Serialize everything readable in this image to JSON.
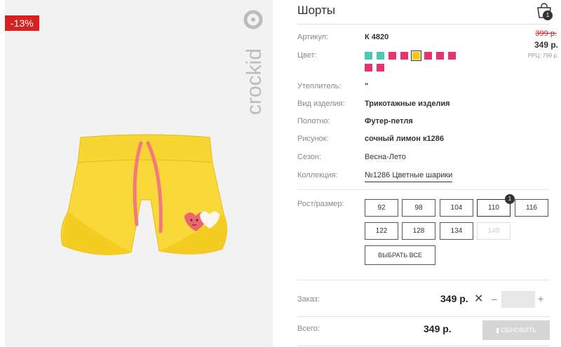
{
  "badge": {
    "discount": "-13%"
  },
  "brand": {
    "logo_text": "crockid"
  },
  "product": {
    "title": "Шорты",
    "cart_count": "1",
    "old_price": "399 р.",
    "price": "349 р.",
    "rrp": "РРЦ: 799 р."
  },
  "fields": [
    {
      "label": "Артикул:",
      "value": "К 4820"
    },
    {
      "label": "Цвет:",
      "value": ""
    },
    {
      "label": "Утеплитель:",
      "value": "\""
    },
    {
      "label": "Вид изделия:",
      "value": "Трикотажные изделия"
    },
    {
      "label": "Полотно:",
      "value": "Футер-петля"
    },
    {
      "label": "Рисунок:",
      "value": "сочный лимон к1286"
    },
    {
      "label": "Сезон:",
      "value": "Весна-Лето"
    },
    {
      "label": "Коллекция:",
      "value": "№1286 Цветные шарики"
    },
    {
      "label": "Рост/размер:",
      "value": ""
    }
  ],
  "colors": [
    "#4cc9b5",
    "#4cc9b5",
    "#e8336f",
    "#e8336f",
    "#f6c81d",
    "#e8336f",
    "#e8336f",
    "#e8336f",
    "#e8336f",
    "#e8336f"
  ],
  "selected_color_index": 4,
  "sizes": [
    {
      "label": "92",
      "state": "normal"
    },
    {
      "label": "98",
      "state": "normal"
    },
    {
      "label": "104",
      "state": "normal"
    },
    {
      "label": "110",
      "state": "active",
      "badge": "1"
    },
    {
      "label": "116",
      "state": "normal"
    },
    {
      "label": "122",
      "state": "normal"
    },
    {
      "label": "128",
      "state": "normal"
    },
    {
      "label": "134",
      "state": "normal"
    },
    {
      "label": "140",
      "state": "disabled"
    }
  ],
  "select_all_label": "ВЫБРАТЬ ВСЕ",
  "order": {
    "label": "Заказ:",
    "price": "349 р.",
    "remove": "✕",
    "minus": "–",
    "plus": "+",
    "quantity": ""
  },
  "total": {
    "label": "Всего:",
    "price": "349 р.",
    "update_label": "ОБНОВИТЬ"
  },
  "accent": "#d8221f"
}
